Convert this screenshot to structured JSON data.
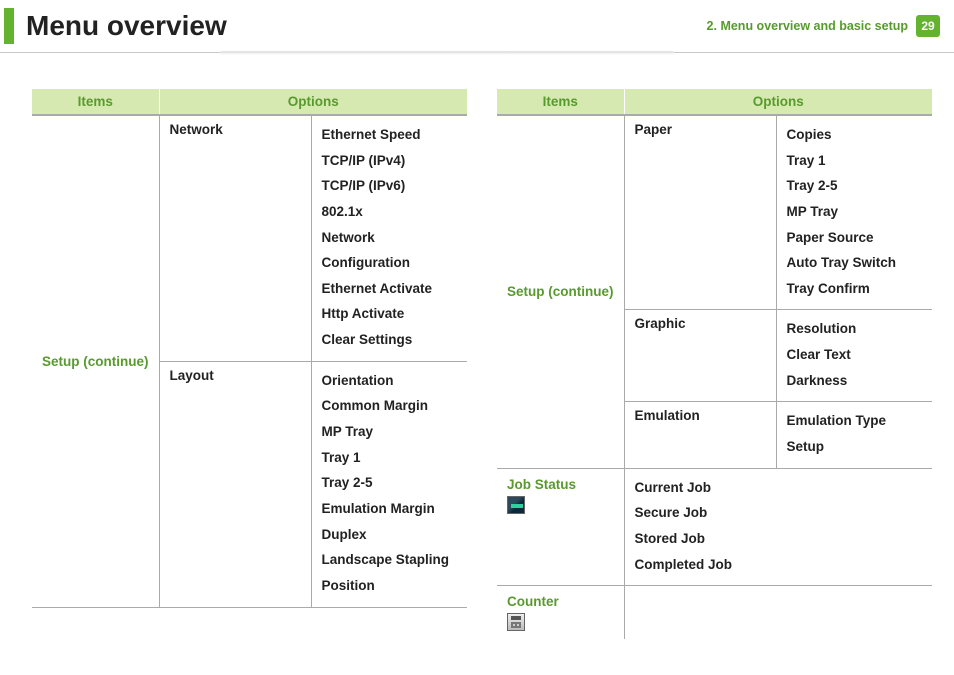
{
  "header": {
    "title": "Menu overview",
    "chapter": "2.  Menu overview and basic setup",
    "page_number": "29"
  },
  "tables": {
    "left": {
      "head_items": "Items",
      "head_options": "Options",
      "row_head": "Setup (continue)",
      "groups": [
        {
          "label": "Network",
          "options": [
            "Ethernet Speed",
            "TCP/IP (IPv4)",
            "TCP/IP (IPv6)",
            "802.1x",
            "Network Configuration",
            "Ethernet Activate",
            "Http Activate",
            "Clear Settings"
          ]
        },
        {
          "label": "Layout",
          "options": [
            "Orientation",
            "Common Margin",
            "MP Tray",
            "Tray 1",
            "Tray 2-5",
            "Emulation Margin",
            "Duplex",
            "Landscape Stapling Position"
          ]
        }
      ]
    },
    "right": {
      "head_items": "Items",
      "head_options": "Options",
      "setup_row_head": "Setup (continue)",
      "setup_groups": [
        {
          "label": "Paper",
          "options": [
            "Copies",
            "Tray 1",
            "Tray 2-5",
            "MP Tray",
            "Paper Source",
            "Auto Tray Switch",
            "Tray Confirm"
          ]
        },
        {
          "label": "Graphic",
          "options": [
            "Resolution",
            "Clear Text",
            "Darkness"
          ]
        },
        {
          "label": "Emulation",
          "options": [
            "Emulation Type",
            "Setup"
          ]
        }
      ],
      "jobstatus_row_head": "Job Status",
      "jobstatus_items": [
        "Current Job",
        "Secure Job",
        "Stored Job",
        "Completed Job"
      ],
      "counter_row_head": "Counter"
    }
  }
}
